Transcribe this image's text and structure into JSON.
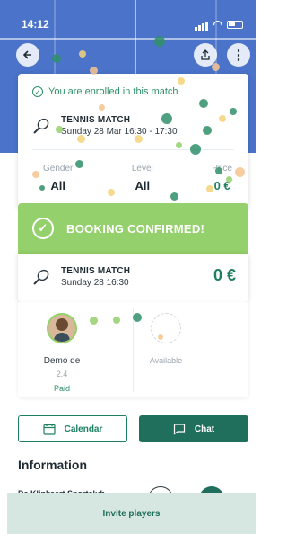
{
  "status_bar": {
    "time": "14:12"
  },
  "header": {
    "back_icon": "back-arrow-icon",
    "share_icon": "share-icon",
    "more_icon": "more-vertical-icon"
  },
  "match_card": {
    "enrolled_text": "You are enrolled in this match",
    "title": "TENNIS MATCH",
    "date": "Sunday 28 Mar 16:30 - 17:30",
    "stats": [
      {
        "label": "Gender",
        "value": "All"
      },
      {
        "label": "Level",
        "value": "All"
      },
      {
        "label": "Price",
        "value": "0 €"
      }
    ]
  },
  "confirmation": {
    "banner_text": "BOOKING CONFIRMED!",
    "title": "TENNIS MATCH",
    "date": "Sunday 28 16:30",
    "price": "0 €"
  },
  "players": [
    {
      "name": "Demo de",
      "level": "2.4",
      "status": "Paid"
    },
    {
      "status": "Available"
    }
  ],
  "actions": {
    "calendar_label": "Calendar",
    "chat_label": "Chat"
  },
  "information": {
    "title": "Information",
    "club_name": "De Klinkaert Sportclub"
  },
  "invite": {
    "label": "Invite players"
  },
  "colors": {
    "primary": "#1f6f5c",
    "success": "#94d06b",
    "accent": "#2f8f6a"
  }
}
